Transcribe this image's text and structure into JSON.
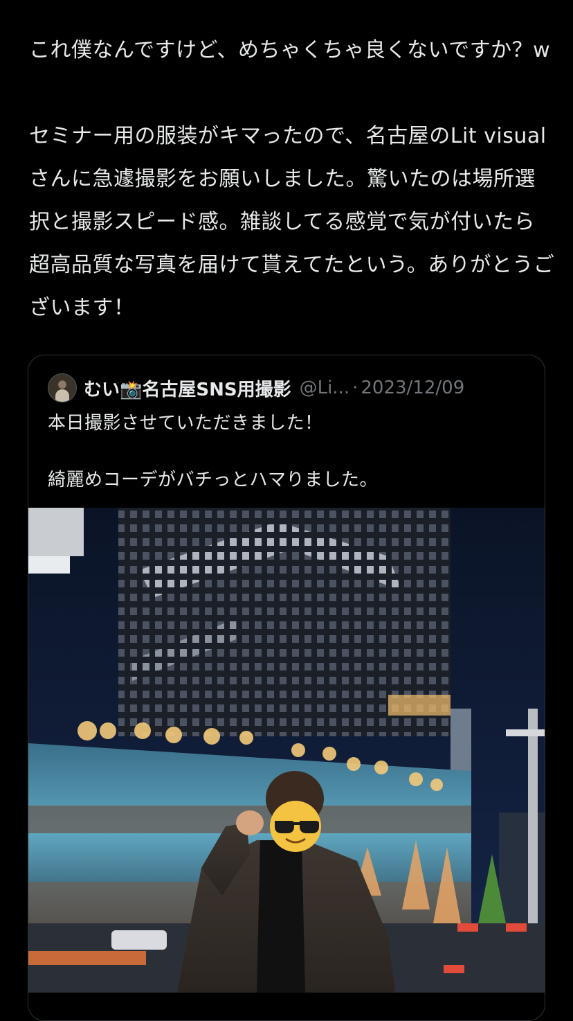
{
  "tweet": {
    "text": "これ僕なんですけど、めちゃくちゃ良くないですか？w\n\nセミナー用の服装がキマったので、名古屋のLit visual さんに急遽撮影をお願いしました。驚いたのは場所選択と撮影スピード感。雑談してる感覚で気が付いたら超高品質な写真を届けて貰えてたという。ありがとうございます！"
  },
  "quoted_tweet": {
    "display_name": "むい📸名古屋SNS用撮影",
    "handle": "@Li...",
    "separator": "·",
    "date": "2023/12/09",
    "text": "本日撮影させていただきました！\n\n綺麗めコーデがバチっとハマりました。",
    "avatar_icon": "profile-photo",
    "media_icon": "photo"
  },
  "colors": {
    "background": "#000000",
    "text": "#e7e9ea",
    "muted": "#71767b",
    "border": "#2f3336"
  }
}
